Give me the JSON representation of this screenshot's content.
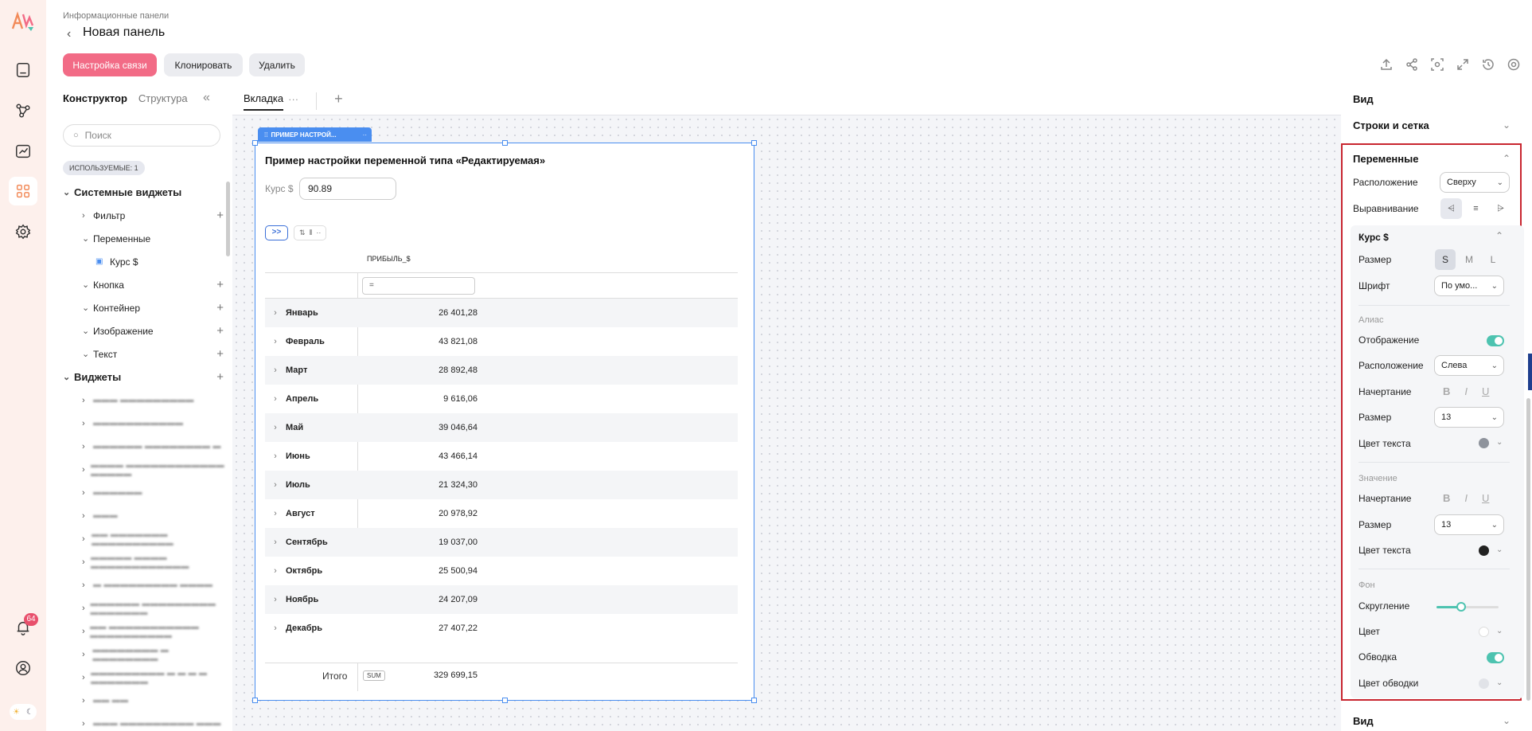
{
  "header": {
    "breadcrumb": "Информационные панели",
    "title": "Новая панель",
    "buttons": {
      "link_settings": "Настройка связи",
      "clone": "Клонировать",
      "delete": "Удалить"
    }
  },
  "notifications": {
    "count": "64"
  },
  "constructor": {
    "tabs": [
      "Конструктор",
      "Структура"
    ],
    "search_placeholder": "Поиск",
    "used_chip": "ИСПОЛЬЗУЕМЫЕ: 1",
    "system_group": "Системные виджеты",
    "system_items": {
      "filter": "Фильтр",
      "variables": "Переменные",
      "variable_child": "Курс $",
      "button": "Кнопка",
      "container": "Контейнер",
      "image": "Изображение",
      "text": "Текст"
    },
    "widgets_group": "Виджеты"
  },
  "canvas": {
    "tab_label": "Вкладка"
  },
  "widget": {
    "tag": "ПРИМЕР НАСТРОЙ...",
    "title": "Пример настройки переменной типа «Редактируемая»",
    "var_label": "Курс $",
    "var_value": "90.89",
    "expand_label": ">>",
    "column_header": "ПРИБЫЛЬ_$",
    "filter_symbol": "=",
    "rows": [
      {
        "label": "Январь",
        "value": "26 401,28"
      },
      {
        "label": "Февраль",
        "value": "43 821,08"
      },
      {
        "label": "Март",
        "value": "28 892,48"
      },
      {
        "label": "Апрель",
        "value": "9 616,06"
      },
      {
        "label": "Май",
        "value": "39 046,64"
      },
      {
        "label": "Июнь",
        "value": "43 466,14"
      },
      {
        "label": "Июль",
        "value": "21 324,30"
      },
      {
        "label": "Август",
        "value": "20 978,92"
      },
      {
        "label": "Сентябрь",
        "value": "19 037,00"
      },
      {
        "label": "Октябрь",
        "value": "25 500,94"
      },
      {
        "label": "Ноябрь",
        "value": "24 207,09"
      },
      {
        "label": "Декабрь",
        "value": "27 407,22"
      }
    ],
    "total_label": "Итого",
    "total_agg": "SUM",
    "total_value": "329 699,15"
  },
  "properties": {
    "view_top": "Вид",
    "rows_grid": "Строки и сетка",
    "variables_section": "Переменные",
    "placement_label": "Расположение",
    "placement_value": "Сверху",
    "align_label": "Выравнивание",
    "card_title": "Курс $",
    "size_label": "Размер",
    "sizes": [
      "S",
      "M",
      "L"
    ],
    "font_label": "Шрифт",
    "font_value": "По умо...",
    "alias_head": "Алиас",
    "display_label": "Отображение",
    "alias_placement_label": "Расположение",
    "alias_placement_value": "Слева",
    "style_label": "Начертание",
    "alias_size_label": "Размер",
    "alias_size_value": "13",
    "text_color_label": "Цвет текста",
    "value_head": "Значение",
    "value_style_label": "Начертание",
    "value_size_label": "Размер",
    "value_size_value": "13",
    "value_color_label": "Цвет текста",
    "bg_head": "Фон",
    "rounding_label": "Скругление",
    "rounding_level": 0.4,
    "color_label": "Цвет",
    "border_label": "Обводка",
    "border_color_label": "Цвет обводки",
    "view_bottom": "Вид",
    "style_letters": [
      "B",
      "I",
      "U"
    ],
    "colors": {
      "alias_text": "#8e939c",
      "value_text": "#222222",
      "bg": "#ffffff",
      "border": "#e1e3e8",
      "accent": "#4dc3b0"
    }
  }
}
